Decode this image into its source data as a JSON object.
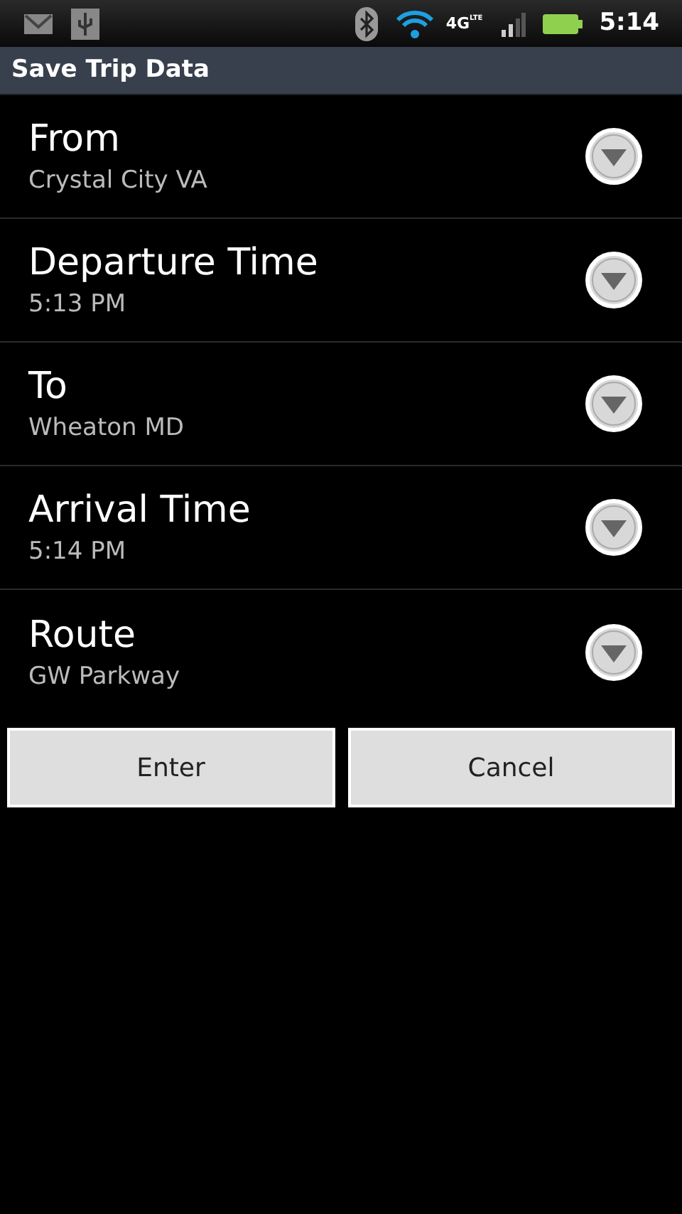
{
  "status_bar": {
    "network": "4G",
    "network_sub": "LTE",
    "time": "5:14"
  },
  "title_bar": {
    "title": "Save Trip Data"
  },
  "fields": [
    {
      "label": "From",
      "value": "Crystal City VA"
    },
    {
      "label": "Departure Time",
      "value": "5:13 PM"
    },
    {
      "label": "To",
      "value": "Wheaton MD"
    },
    {
      "label": "Arrival Time",
      "value": "5:14 PM"
    },
    {
      "label": "Route",
      "value": "GW Parkway"
    }
  ],
  "buttons": [
    "Enter",
    "Cancel"
  ]
}
